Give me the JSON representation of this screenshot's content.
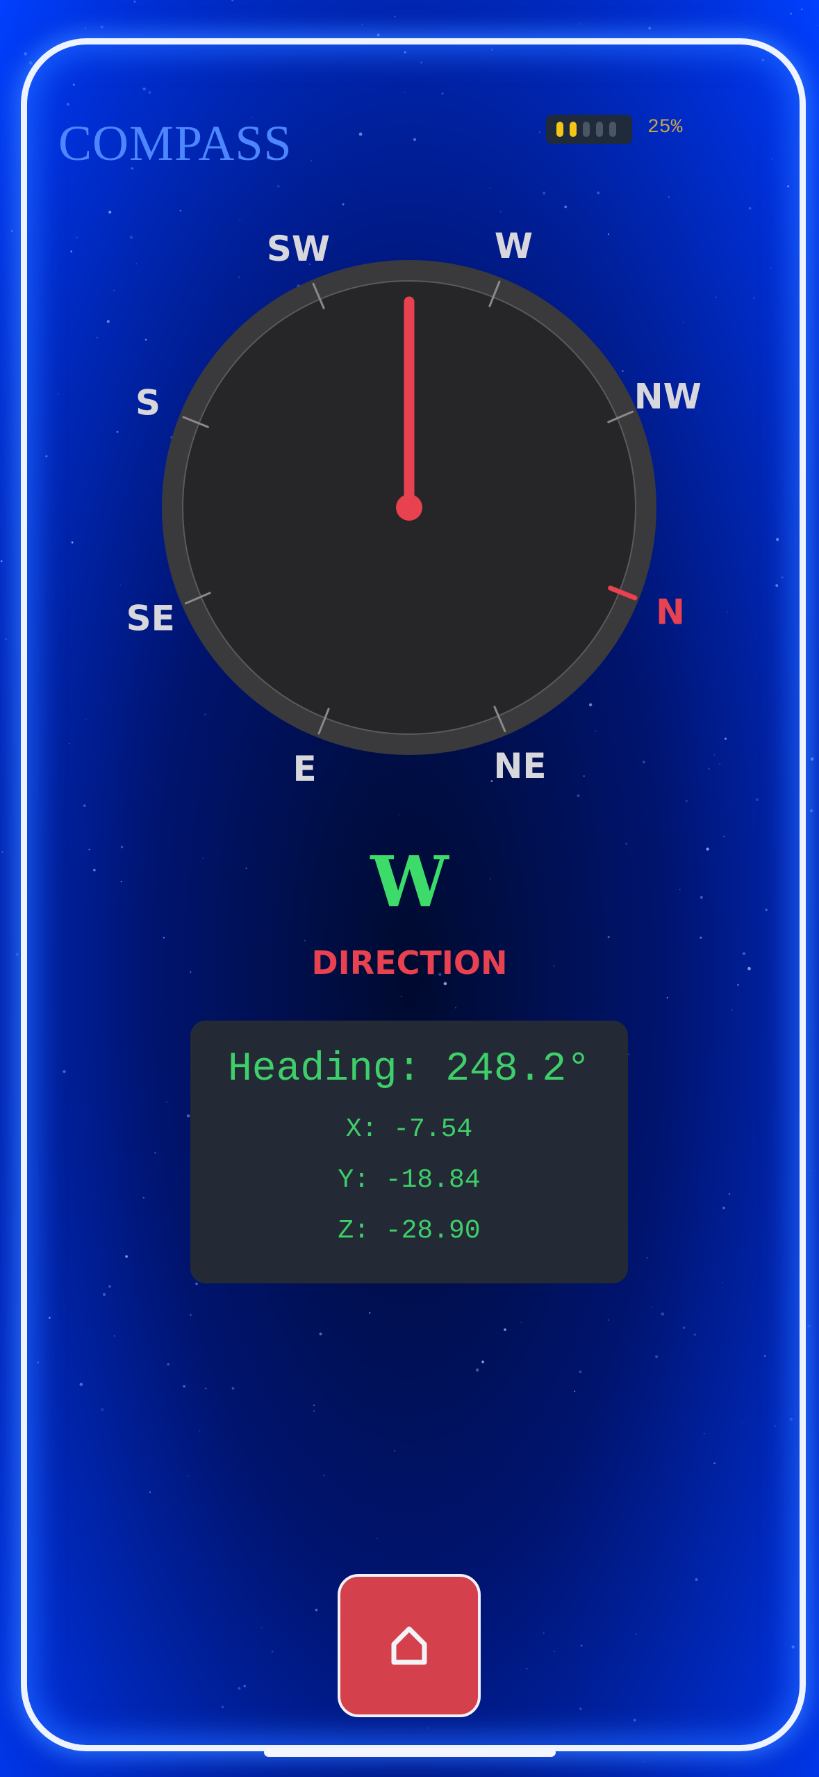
{
  "app": {
    "title": "COMPASS"
  },
  "status": {
    "battery_percent": 25,
    "battery_label": "25%",
    "battery_segments_total": 5,
    "battery_segments_on": 2
  },
  "compass": {
    "rotation_deg": 111.8,
    "needle_angle_deg": 0,
    "labels": [
      {
        "text": "N",
        "color": "#e8414f",
        "highlight": true
      },
      {
        "text": "NE",
        "color": "#d8d8dc",
        "highlight": false
      },
      {
        "text": "E",
        "color": "#d8d8dc",
        "highlight": false
      },
      {
        "text": "SE",
        "color": "#d8d8dc",
        "highlight": false
      },
      {
        "text": "S",
        "color": "#d8d8dc",
        "highlight": false
      },
      {
        "text": "SW",
        "color": "#d8d8dc",
        "highlight": false
      },
      {
        "text": "W",
        "color": "#d8d8dc",
        "highlight": false
      },
      {
        "text": "NW",
        "color": "#d8d8dc",
        "highlight": false
      }
    ]
  },
  "current": {
    "direction": "W",
    "caption": "DIRECTION"
  },
  "readout": {
    "heading": "Heading: 248.2°",
    "x": "X: -7.54",
    "y": "Y: -18.84",
    "z": "Z: -28.90"
  },
  "nav": {
    "home_icon": "home-icon"
  },
  "colors": {
    "accent_red": "#e8414f",
    "accent_green": "#3ddc6a",
    "title_blue": "#4d86ff",
    "battery_yellow": "#f5c518"
  }
}
